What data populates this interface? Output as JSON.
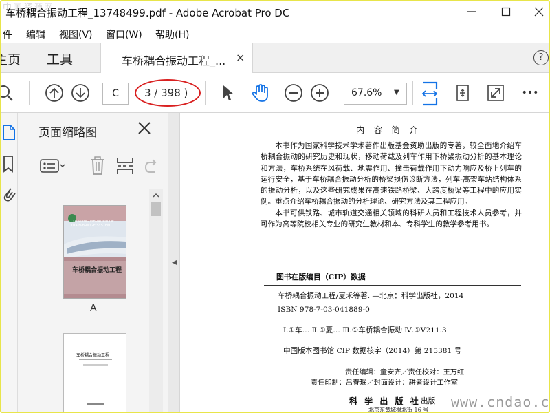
{
  "window": {
    "title": "车桥耦合振动工程_13748499.pdf - Adobe Acrobat Pro DC",
    "watermark": "中国资源网"
  },
  "menu": [
    "件",
    "编辑",
    "视图(V)",
    "窗口(W)",
    "帮助(H)"
  ],
  "tabs": {
    "home": "主页",
    "tools": "工具",
    "document": "车桥耦合振动工程_...",
    "close": "×",
    "help": "?"
  },
  "toolbar": {
    "page_input": "C",
    "page_count": "3 / 398 )",
    "zoom": "67.6%",
    "zoom_caret": "▼",
    "more": "•••",
    "highlight_color": "#d92020",
    "accent_color": "#1473e6"
  },
  "thumbnails": {
    "title": "页面缩略图",
    "pages": [
      {
        "label": "A",
        "cover_title": "车桥耦合振动工程",
        "cover_subtitle": "COUPLING VIBRATION OF TRAIN-BRIDGE SYSTEM"
      },
      {
        "label": "",
        "cover_title": "车桥耦合振动工程"
      }
    ]
  },
  "document": {
    "heading": "内 容 简 介",
    "paragraphs": [
      "本书作为国家科学技术学术著作出版基金资助出版的专著，较全面地介绍车桥耦合振动的研究历史和现状，移动荷载及列车作用下桥梁振动分析的基本理论和方法，车桥系统在风荷载、地震作用、撞击荷载作用下动力响应及桥上列车的运行安全，基于车桥耦合振动分析的桥梁损伤诊断方法，列车-高架车站结构体系的振动分析，以及这些研究成果在高速铁路桥梁、大跨度桥梁等工程中的应用实例。重点介绍车桥耦合振动的分析理论、研究方法及其工程应用。",
      "本书可供铁路、城市轨道交通相关领域的科研人员和工程技术人员参考，并可作为高等院校相关专业的研究生教材和本、专科学生的教学参考用书。"
    ],
    "cip_title": "图书在版编目（CIP）数据",
    "cip_lines": [
      "车桥耦合振动工程/夏禾等著. —北京：科学出版社，2014",
      "ISBN 978-7-03-041889-0",
      "Ⅰ.①车…   Ⅱ.①夏…   Ⅲ.①车桥耦合振动   Ⅳ.①V211.3",
      "中国版本图书馆 CIP 数据核字（2014）第 215381 号"
    ],
    "responsibility_1": "责任编辑：童安齐／责任校对：王万红",
    "responsibility_2": "责任印制：吕春珉／封面设计：耕者设计工作室",
    "publisher_name": "科 学 出 版 社",
    "publisher_suffix": "出版",
    "publisher_address": "北京东黄城根北街 16 号"
  },
  "site_watermark": "www.cndao.com"
}
